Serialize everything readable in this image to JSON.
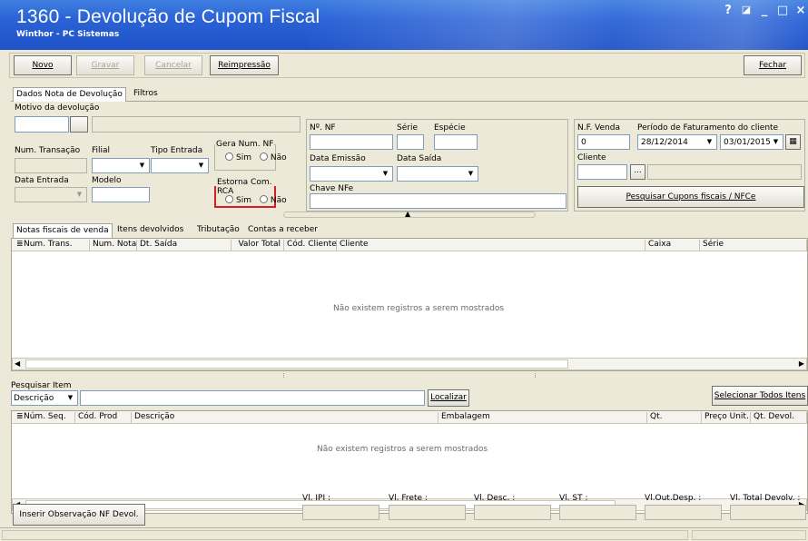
{
  "window": {
    "title": "1360 - Devolução de Cupom Fiscal",
    "subtitle": "Winthor - PC Sistemas",
    "controls": {
      "help": "?",
      "restore": "◪",
      "minimize": "_",
      "maximize": "□",
      "close": "×"
    }
  },
  "toolbar": {
    "novo": "Novo",
    "gravar": "Gravar",
    "cancelar": "Cancelar",
    "reimpressao": "Reimpressão",
    "fechar": "Fechar"
  },
  "tabs": {
    "dados": "Dados Nota de Devolução",
    "filtros": "Filtros"
  },
  "form": {
    "motivo_label": "Motivo da devolução",
    "num_transacao_label": "Num. Transação",
    "filial_label": "Filial",
    "tipo_entrada_label": "Tipo Entrada",
    "gera_num_nf_label": "Gera Num. NF",
    "sim": "Sim",
    "nao": "Não",
    "data_entrada_label": "Data Entrada",
    "modelo_label": "Modelo",
    "estorna_label": "Estorna Com. RCA",
    "nf_label": "Nº. NF",
    "serie_label": "Série",
    "especie_label": "Espécie",
    "data_emissao_label": "Data Emissão",
    "data_saida_label": "Data Saída",
    "chave_nfe_label": "Chave NFe",
    "nf_venda_label": "N.F. Venda",
    "nf_venda_value": "0",
    "periodo_label": "Período de Faturamento do cliente",
    "periodo_inicio": "28/12/2014",
    "periodo_fim": "03/01/2015",
    "cliente_label": "Cliente",
    "ellipsis": "...",
    "pesquisar_cupons": "Pesquisar Cupons fiscais / NFCe"
  },
  "subtabs": [
    "Notas fiscais de venda",
    "Itens devolvidos",
    "Tributação",
    "Contas a receber"
  ],
  "grid1": {
    "columns": [
      "Num. Trans.",
      "Num. Nota",
      "Dt. Saída",
      "Valor Total",
      "Cód. Cliente",
      "Cliente",
      "Caixa",
      "Série"
    ],
    "empty": "Não existem registros a serem mostrados"
  },
  "search": {
    "label": "Pesquisar Item",
    "field_value": "Descrição",
    "localizar": "Localizar",
    "selecionar_todos": "Selecionar Todos Itens"
  },
  "grid2": {
    "columns": [
      "Núm. Seq.",
      "Cód. Prod",
      "Descrição",
      "Embalagem",
      "Qt.",
      "Preço Unit.",
      "Qt. Devol."
    ],
    "empty": "Não existem registros a serem mostrados"
  },
  "footer": {
    "inserir_obs": "Inserir Observação NF Devol.",
    "vl_ipi": "Vl. IPI :",
    "vl_frete": "Vl. Frete :",
    "vl_desc": "Vl. Desc. :",
    "vl_st": "Vl. ST :",
    "vl_out_desp": "Vl.Out.Desp. :",
    "vl_total_devolv": "Vl. Total Devolv. :"
  },
  "colors": {
    "title_blue": "#2a62d6",
    "highlight_red": "#d42020",
    "face": "#ece9d8"
  }
}
